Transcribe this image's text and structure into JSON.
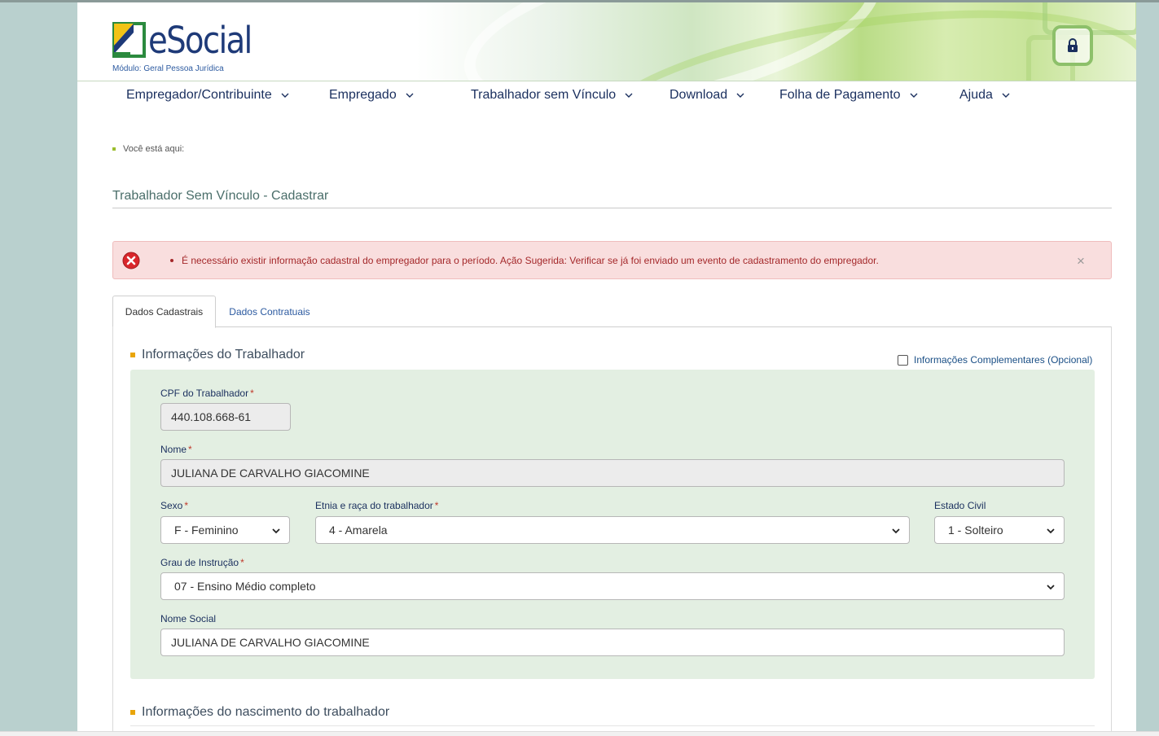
{
  "header": {
    "logo_text": "eSocial",
    "module_text": "Módulo: Geral Pessoa Jurídica"
  },
  "nav": {
    "items": [
      {
        "label": "Empregador/Contribuinte"
      },
      {
        "label": "Empregado"
      },
      {
        "label": "Trabalhador sem Vínculo"
      },
      {
        "label": "Download"
      },
      {
        "label": "Folha de Pagamento"
      },
      {
        "label": "Ajuda"
      }
    ]
  },
  "breadcrumb": {
    "label": "Você está aqui:"
  },
  "page_title": "Trabalhador Sem Vínculo - Cadastrar",
  "alert": {
    "message": "É necessário existir informação cadastral do empregador para o período. Ação Sugerida: Verificar se já foi enviado um evento de cadastramento do empregador.",
    "close": "×"
  },
  "tabs": [
    {
      "label": "Dados Cadastrais",
      "active": true
    },
    {
      "label": "Dados Contratuais",
      "active": false
    }
  ],
  "section_worker": {
    "title": "Informações do Trabalhador",
    "optional_label": "Informações Complementares (Opcional)"
  },
  "form": {
    "cpf": {
      "label": "CPF do Trabalhador",
      "required": "*",
      "value": "440.108.668-61"
    },
    "nome": {
      "label": "Nome",
      "required": "*",
      "value": "JULIANA DE CARVALHO GIACOMINE"
    },
    "sexo": {
      "label": "Sexo",
      "required": "*",
      "value": "F - Feminino"
    },
    "etnia": {
      "label": "Etnia e raça do trabalhador",
      "required": "*",
      "value": "4 - Amarela"
    },
    "estado_civil": {
      "label": "Estado Civil",
      "value": "1 - Solteiro"
    },
    "grau_instrucao": {
      "label": "Grau de Instrução",
      "required": "*",
      "value": "07 - Ensino Médio completo"
    },
    "nome_social": {
      "label": "Nome Social",
      "value": "JULIANA DE CARVALHO GIACOMINE"
    }
  },
  "section_birth": {
    "title": "Informações do nascimento do trabalhador"
  },
  "colors": {
    "brand_navy": "#1a2f5e",
    "accent_orange": "#e9a50a",
    "alert_red": "#a4282a",
    "panel_green": "#e3efe2"
  },
  "icons": [
    "lock-icon",
    "chevron-down-icon",
    "error-circle-icon",
    "close-icon",
    "checkbox-icon"
  ]
}
